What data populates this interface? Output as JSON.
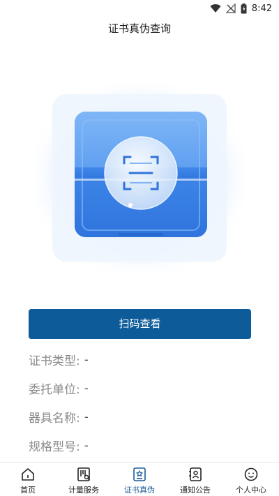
{
  "status_bar": {
    "time": "8:42",
    "icons": [
      "wifi-icon",
      "no-signal-icon",
      "battery-icon"
    ]
  },
  "header": {
    "title": "证书真伪查询"
  },
  "hero": {
    "icon": "scan-icon"
  },
  "scan_button": {
    "label": "扫码查看"
  },
  "info": {
    "rows": [
      {
        "label": "证书类型:",
        "value": "-"
      },
      {
        "label": "委托单位:",
        "value": "-"
      },
      {
        "label": "器具名称:",
        "value": "-"
      },
      {
        "label": "规格型号:",
        "value": "-"
      }
    ]
  },
  "tabs": [
    {
      "label": "首页",
      "icon": "home-icon",
      "active": false
    },
    {
      "label": "计量服务",
      "icon": "measure-service-icon",
      "active": false
    },
    {
      "label": "证书真伪",
      "icon": "certificate-icon",
      "active": true
    },
    {
      "label": "通知公告",
      "icon": "notice-icon",
      "active": false
    },
    {
      "label": "个人中心",
      "icon": "profile-icon",
      "active": false
    }
  ],
  "colors": {
    "accent": "#0e5b9a",
    "tab_active": "#1a5c99"
  }
}
